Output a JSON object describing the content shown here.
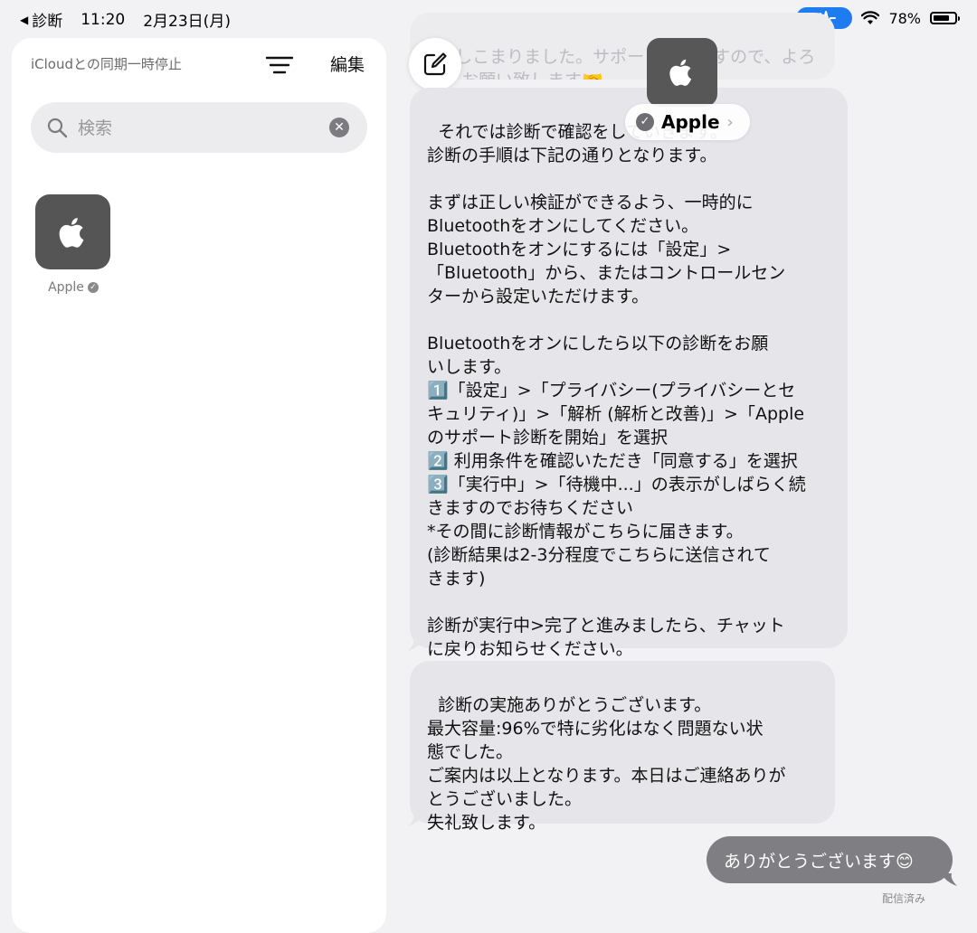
{
  "status_bar": {
    "back_app": "診断",
    "time": "11:20",
    "date": "2月23日(月)",
    "battery": "78%",
    "battery_level": 0.78
  },
  "sidebar": {
    "sync_text": "iCloudとの同期一時停止",
    "edit_label": "編集",
    "search_placeholder": "検索",
    "contact_name": "Apple"
  },
  "chat": {
    "contact_name": "Apple",
    "messages": [
      {
        "from": "Apple",
        "text": "かしこまりました。サポート致しますので、よろしくお願い致します🤝"
      },
      {
        "from": "Apple",
        "text": "それでは診断で確認をしていきます。\n診断の手順は下記の通りとなります。\n\nまずは正しい検証ができるよう、一時的に\nBluetoothをオンにしてください。\nBluetoothをオンにするには「設定」>\n「Bluetooth」から、またはコントロールセン\nターから設定いただけます。\n\nBluetoothをオンにしたら以下の診断をお願\nいします。\n1️⃣「設定」>「プライバシー(プライバシーとセ\nキュリティ)」>「解析 (解析と改善)」>「Apple\nのサポート診断を開始」を選択\n2️⃣ 利用条件を確認いただき「同意する」を選択\n3️⃣「実行中」>「待機中...」の表示がしばらく続\nきますのでお待ちください\n*その間に診断情報がこちらに届きます。\n(診断結果は2-3分程度でこちらに送信されて\nきます)\n\n診断が実行中>完了と進みましたら、チャット\nに戻りお知らせください。"
      },
      {
        "from": "Apple",
        "text": "診断の実施ありがとうございます。\n最大容量:96%で特に劣化はなく問題ない状\n態でした。\nご案内は以上となります。本日はご連絡ありが\nとうございました。\n失礼致します。"
      },
      {
        "from": "me",
        "text": "ありがとうございます😊"
      }
    ],
    "delivered_label": "配信済み"
  },
  "colors": {
    "accent": "#1f7bf0",
    "bubble_received": "#e6e6ea",
    "bubble_sent": "#7e7e83",
    "background": "#f2f2f4"
  }
}
